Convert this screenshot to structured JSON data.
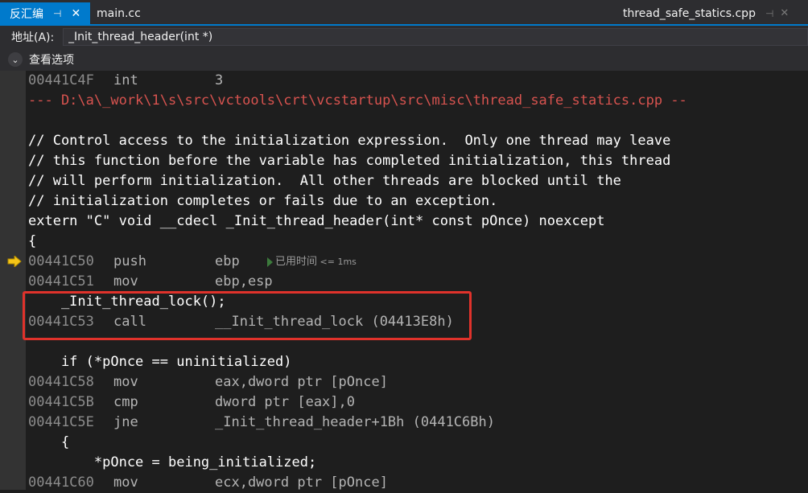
{
  "tabs": {
    "active_label": "反汇编",
    "inactive_label": "main.cc",
    "right_label": "thread_safe_statics.cpp"
  },
  "address": {
    "label": "地址(A):",
    "value": "_Init_thread_header(int *)"
  },
  "options": {
    "label": "查看选项"
  },
  "instruction_pointer_line": "00441C50",
  "elapsed_hint": {
    "prefix": "已用时间",
    "value": "<= 1ms"
  },
  "lines": [
    {
      "type": "asm",
      "addr": "00441C4F",
      "op": "int",
      "args": "3"
    },
    {
      "type": "source",
      "text": "--- D:\\a\\_work\\1\\s\\src\\vctools\\crt\\vcstartup\\src\\misc\\thread_safe_statics.cpp --"
    },
    {
      "type": "blank",
      "text": ""
    },
    {
      "type": "code",
      "text": "// Control access to the initialization expression.  Only one thread may leave"
    },
    {
      "type": "code",
      "text": "// this function before the variable has completed initialization, this thread"
    },
    {
      "type": "code",
      "text": "// will perform initialization.  All other threads are blocked until the"
    },
    {
      "type": "code",
      "text": "// initialization completes or fails due to an exception."
    },
    {
      "type": "code",
      "text": "extern \"C\" void __cdecl _Init_thread_header(int* const pOnce) noexcept"
    },
    {
      "type": "code",
      "text": "{"
    },
    {
      "type": "asm",
      "addr": "00441C50",
      "op": "push",
      "args": "ebp"
    },
    {
      "type": "asm",
      "addr": "00441C51",
      "op": "mov",
      "args": "ebp,esp"
    },
    {
      "type": "code",
      "text": "    _Init_thread_lock();"
    },
    {
      "type": "asm",
      "addr": "00441C53",
      "op": "call",
      "args": "__Init_thread_lock (04413E8h)"
    },
    {
      "type": "blank",
      "text": ""
    },
    {
      "type": "code",
      "text": "    if (*pOnce == uninitialized)"
    },
    {
      "type": "asm",
      "addr": "00441C58",
      "op": "mov",
      "args": "eax,dword ptr [pOnce]"
    },
    {
      "type": "asm",
      "addr": "00441C5B",
      "op": "cmp",
      "args": "dword ptr [eax],0"
    },
    {
      "type": "asm",
      "addr": "00441C5E",
      "op": "jne",
      "args": "_Init_thread_header+1Bh (0441C6Bh)"
    },
    {
      "type": "code",
      "text": "    {"
    },
    {
      "type": "code",
      "text": "        *pOnce = being_initialized;"
    },
    {
      "type": "asm",
      "addr": "00441C60",
      "op": "mov",
      "args": "ecx,dword ptr [pOnce]"
    }
  ]
}
